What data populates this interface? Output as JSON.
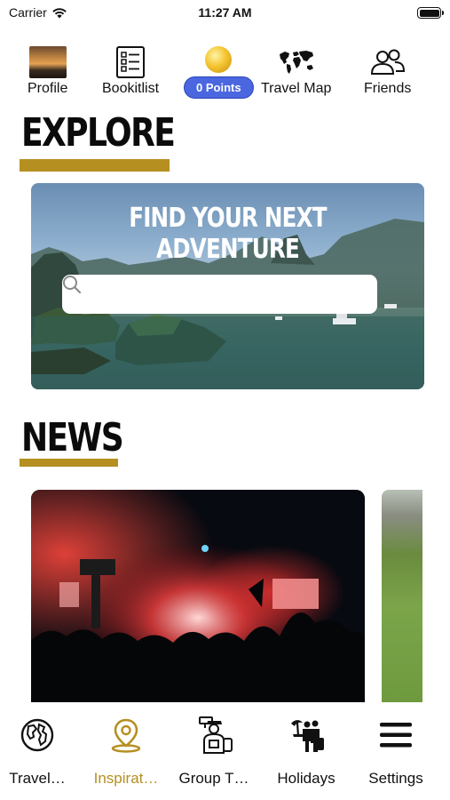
{
  "status_bar": {
    "carrier": "Carrier",
    "time": "11:27 AM"
  },
  "top_nav": {
    "profile": "Profile",
    "bucketlist": "Bookitlist",
    "points": "0 Points",
    "travel_map": "Travel Map",
    "friends": "Friends"
  },
  "explore": {
    "title": "EXPLORE",
    "headline": "FIND YOUR NEXT ADVENTURE",
    "search_placeholder": ""
  },
  "news": {
    "title": "NEWS"
  },
  "tab_bar": {
    "items": [
      {
        "label": "Travel…",
        "icon": "globe-icon"
      },
      {
        "label": "Inspirat…",
        "icon": "map-pin-icon",
        "active": true
      },
      {
        "label": "Group T…",
        "icon": "traveler-icon"
      },
      {
        "label": "Holidays",
        "icon": "holiday-icon"
      },
      {
        "label": "Settings",
        "icon": "menu-icon"
      }
    ]
  },
  "colors": {
    "accent_gold": "#b58f20",
    "points_blue": "#4a67e0",
    "active_tab": "#b58f20"
  }
}
